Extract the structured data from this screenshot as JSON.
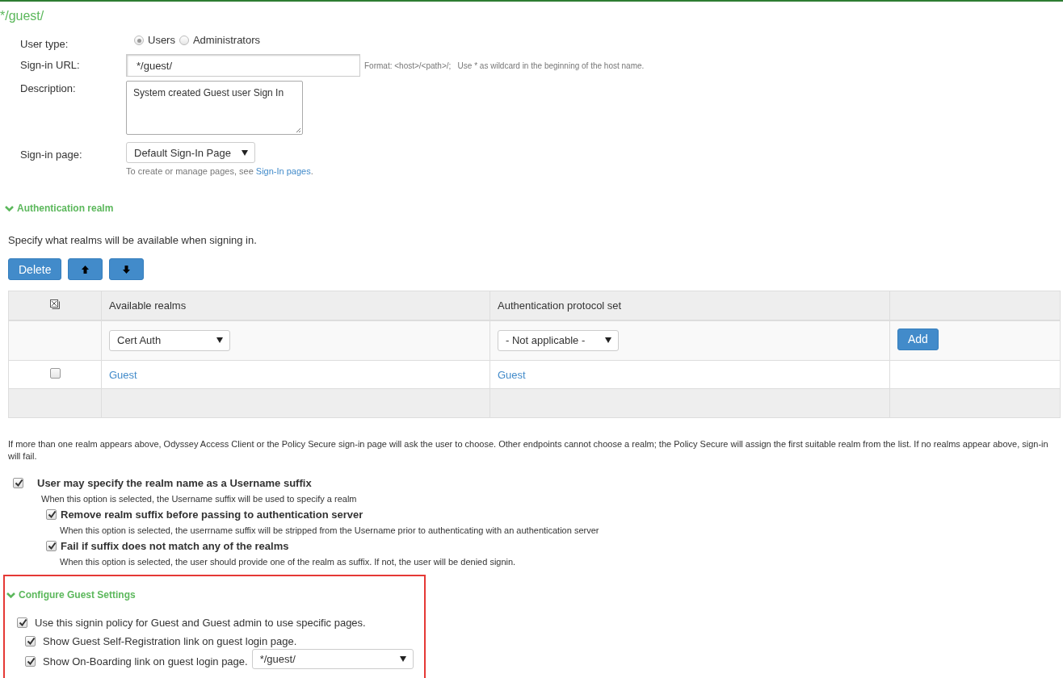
{
  "title": "*/guest/",
  "fields": {
    "user_type": {
      "label": "User type:",
      "options": [
        {
          "label": "Users",
          "selected": true
        },
        {
          "label": "Administrators",
          "selected": false
        }
      ]
    },
    "signin_url": {
      "label": "Sign-in URL:",
      "value": "*/guest/",
      "hint": "Format: <host>/<path>/;   Use * as wildcard in the beginning of the host name."
    },
    "description": {
      "label": "Description:",
      "value": "System created Guest user Sign In"
    },
    "signin_page": {
      "label": "Sign-in page:",
      "value": "Default Sign-In Page",
      "help": "To create or manage pages, see",
      "help_link": "Sign-In pages",
      "help_end": "."
    }
  },
  "auth_realm": {
    "heading": "Authentication realm",
    "expanded": true,
    "intro": "Specify what realms will be available when signing in.",
    "buttons": [
      {
        "kind": "text",
        "label": "Delete"
      },
      {
        "kind": "up"
      },
      {
        "kind": "down"
      }
    ],
    "table": {
      "columns": [
        "Available realms",
        "Authentication protocol set"
      ],
      "add_row": {
        "realm": "Cert Auth",
        "protocol": "- Not applicable -",
        "button": "Add"
      },
      "rows": [
        {
          "checked": false,
          "realm": "Guest",
          "protocol": "Guest"
        }
      ]
    },
    "note": "If more than one realm appears above, Odyssey Access Client or the Policy Secure sign-in page will ask the user to choose. Other endpoints cannot choose a realm; the Policy Secure will assign the first suitable realm from the list. If no realms appear above, sign-in will fail.",
    "options": [
      {
        "label": "User may specify the realm name as a Username suffix",
        "checked": true,
        "description": "When this option is selected, the Username suffix will be used to specify a realm",
        "children": [
          {
            "label": "Remove realm suffix before passing to authentication server",
            "checked": true,
            "description": "When this option is selected, the userrname suffix will be stripped from the Username prior to authenticating with an authentication server"
          },
          {
            "label": "Fail if suffix does not match any of the realms",
            "checked": true,
            "description": "When this option is selected, the user should provide one of the realm as suffix. If not, the user will be denied signin."
          }
        ]
      }
    ]
  },
  "guest_settings": {
    "heading": "Configure Guest Settings",
    "expanded": true,
    "highlighted": true,
    "options": [
      {
        "label": "Use this signin policy for Guest and Guest admin to use specific pages.",
        "checked": true,
        "children": [
          {
            "label": "Show Guest Self-Registration link on guest login page.",
            "checked": true
          },
          {
            "label": "Show On-Boarding link on guest login page.",
            "checked": true,
            "select": "*/guest/"
          }
        ]
      }
    ]
  }
}
